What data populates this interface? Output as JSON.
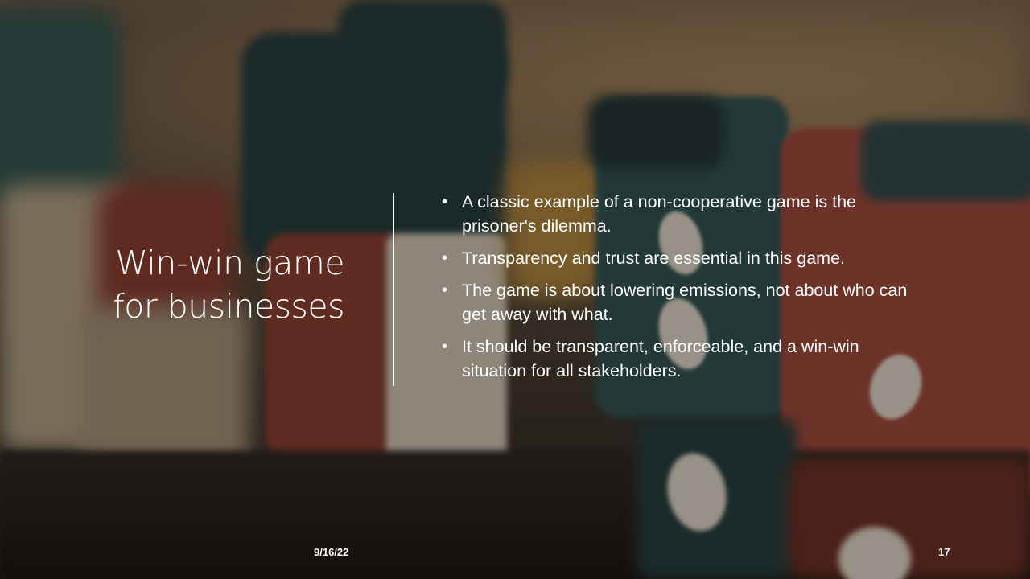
{
  "slide": {
    "title_line1": "Win-win game",
    "title_line2": "for businesses",
    "bullet_symbol": "•",
    "bullets": [
      "A classic example of a non-cooperative game is the prisoner's dilemma.",
      "Transparency and trust are essential in this game.",
      "The game is about lowering emissions, not about who can get away with what.",
      "It should be transparent, enforceable, and a win-win situation for all stakeholders."
    ],
    "date": "9/16/22",
    "page_number": "17"
  },
  "colors": {
    "text": "#ffffff",
    "divider": "#ffffff"
  }
}
